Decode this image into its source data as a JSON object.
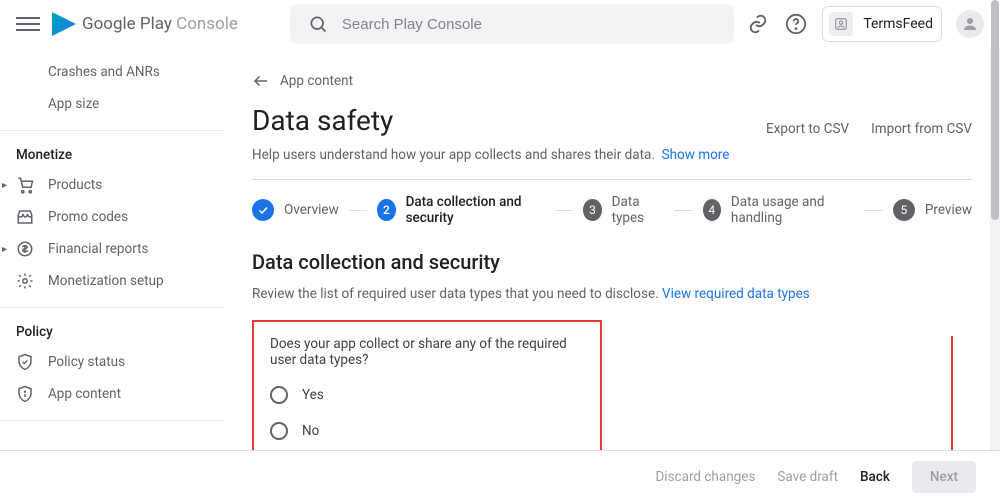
{
  "header": {
    "product_name_a": "Google Play",
    "product_name_b": "Console",
    "search_placeholder": "Search Play Console",
    "account_name": "TermsFeed"
  },
  "sidebar": {
    "items_top": [
      {
        "label": "Crashes and ANRs"
      },
      {
        "label": "App size"
      }
    ],
    "section_monetize": "Monetize",
    "items_monetize": [
      {
        "label": "Products",
        "icon": "cart",
        "caret": true
      },
      {
        "label": "Promo codes",
        "icon": "storefront",
        "caret": false
      },
      {
        "label": "Financial reports",
        "icon": "dollar",
        "caret": true
      },
      {
        "label": "Monetization setup",
        "icon": "gear",
        "caret": false
      }
    ],
    "section_policy": "Policy",
    "items_policy": [
      {
        "label": "Policy status",
        "icon": "shield-check"
      },
      {
        "label": "App content",
        "icon": "shield-info"
      }
    ]
  },
  "breadcrumb": {
    "label": "App content"
  },
  "page": {
    "title": "Data safety",
    "subtitle_text": "Help users understand how your app collects and shares their data.",
    "subtitle_link": "Show more",
    "export_csv": "Export to CSV",
    "import_csv": "Import from CSV"
  },
  "stepper": [
    {
      "label": "Overview",
      "state": "done",
      "badge": "check"
    },
    {
      "label": "Data collection and security",
      "state": "active",
      "badge": "2"
    },
    {
      "label": "Data types",
      "state": "pending",
      "badge": "3"
    },
    {
      "label": "Data usage and handling",
      "state": "pending",
      "badge": "4"
    },
    {
      "label": "Preview",
      "state": "pending",
      "badge": "5"
    }
  ],
  "section": {
    "title": "Data collection and security",
    "desc_text": "Review the list of required user data types that you need to disclose.",
    "desc_link": "View required data types"
  },
  "question": {
    "prompt": "Does your app collect or share any of the required user data types?",
    "option_yes": "Yes",
    "option_no": "No"
  },
  "footer": {
    "discard": "Discard changes",
    "save": "Save draft",
    "back": "Back",
    "next": "Next"
  }
}
